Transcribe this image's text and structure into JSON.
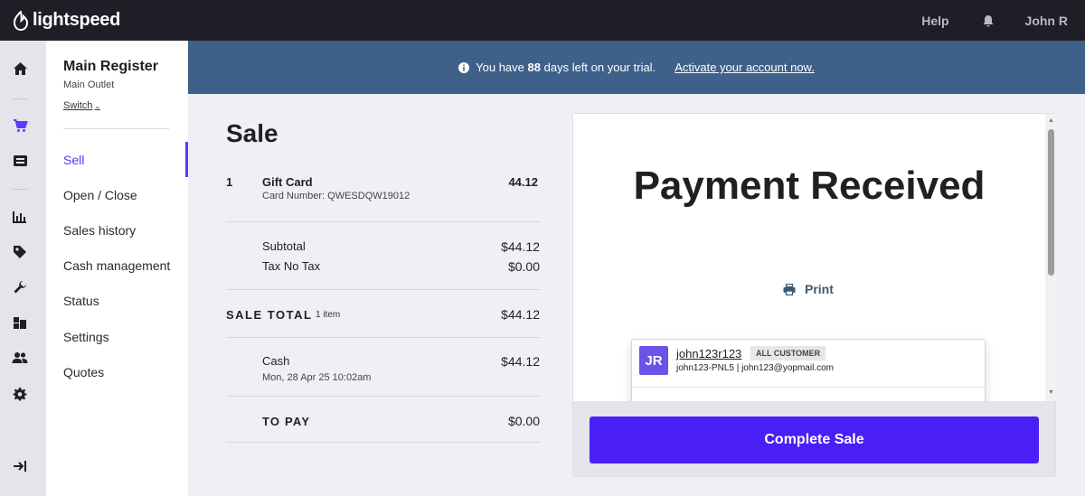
{
  "topbar": {
    "logo_text": "lightspeed",
    "help_label": "Help",
    "user_name": "John R"
  },
  "register": {
    "title": "Main Register",
    "outlet": "Main Outlet",
    "switch_label": "Switch"
  },
  "nav": {
    "items": [
      {
        "label": "Sell",
        "active": true
      },
      {
        "label": "Open / Close"
      },
      {
        "label": "Sales history"
      },
      {
        "label": "Cash management"
      },
      {
        "label": "Status"
      },
      {
        "label": "Settings"
      },
      {
        "label": "Quotes"
      }
    ]
  },
  "banner": {
    "prefix": "You have",
    "days": "88",
    "suffix": "days left on your trial.",
    "activate_label": "Activate your account now."
  },
  "sale": {
    "title": "Sale",
    "line_item": {
      "qty": "1",
      "name": "Gift Card",
      "detail": "Card Number: QWESDQW19012",
      "price": "44.12"
    },
    "subtotal_label": "Subtotal",
    "subtotal_value": "$44.12",
    "tax_label": "Tax No Tax",
    "tax_value": "$0.00",
    "total_label": "SALE TOTAL",
    "total_count": "1 item",
    "total_value": "$44.12",
    "payment_method": "Cash",
    "payment_date": "Mon, 28 Apr 25 10:02am",
    "payment_value": "$44.12",
    "to_pay_label": "TO PAY",
    "to_pay_value": "$0.00"
  },
  "receipt": {
    "title": "Payment Received",
    "print_label": "Print",
    "customer": {
      "initials": "JR",
      "name": "john123r123",
      "badge": "ALL CUSTOMER",
      "detail": "john123-PNL5 | john123@yopmail.com"
    },
    "complete_label": "Complete Sale"
  },
  "colors": {
    "topbar": "#1f1d26",
    "banner": "#3e6089",
    "accent": "#4a1ff5",
    "active_nav": "#5a3ef7"
  }
}
